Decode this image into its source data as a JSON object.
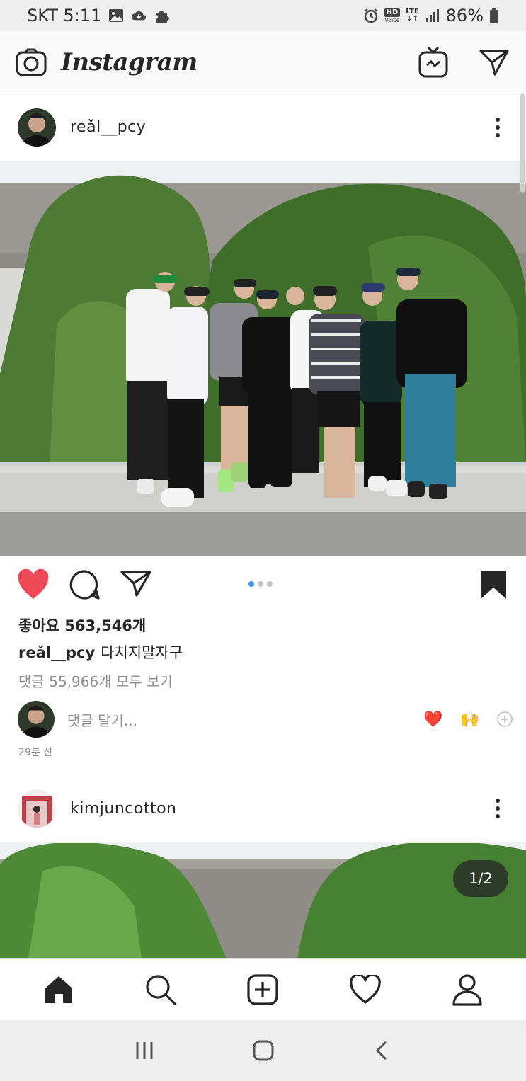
{
  "status_bar": {
    "carrier_time": "SKT 5:11",
    "hd_label": "HD",
    "voice_label": "Voice",
    "lte_label": "LTE",
    "battery": "86%",
    "icons": [
      "gallery-icon",
      "cloud-icon",
      "puzzle-icon",
      "alarm-icon",
      "signal-icon",
      "battery-icon"
    ]
  },
  "header": {
    "logo_text": "Instagram",
    "icons": [
      "camera-icon",
      "igtv-icon",
      "direct-message-icon"
    ]
  },
  "posts": [
    {
      "username": "reǎl__pcy",
      "likes_text": "좋아요 563,546개",
      "caption_user": "reǎl__pcy",
      "caption_text": "다치지말자구",
      "view_comments": "댓글 55,966개 모두 보기",
      "comment_placeholder": "댓글 달기...",
      "quick_reactions": [
        "❤️",
        "🙌"
      ],
      "time_ago": "29분 전",
      "carousel_index": 1,
      "carousel_count": 3,
      "liked": true,
      "saved": true
    },
    {
      "username": "kimjuncotton",
      "counter": "1/2"
    }
  ],
  "bottom_nav": [
    "home-icon",
    "search-icon",
    "new-post-icon",
    "activity-icon",
    "profile-icon"
  ],
  "system_nav": [
    "recents-icon",
    "home-button-icon",
    "back-icon"
  ],
  "colors": {
    "like_red": "#ed4956",
    "accent_blue": "#3897f0",
    "text": "#262626",
    "muted": "#8e8e8e"
  }
}
